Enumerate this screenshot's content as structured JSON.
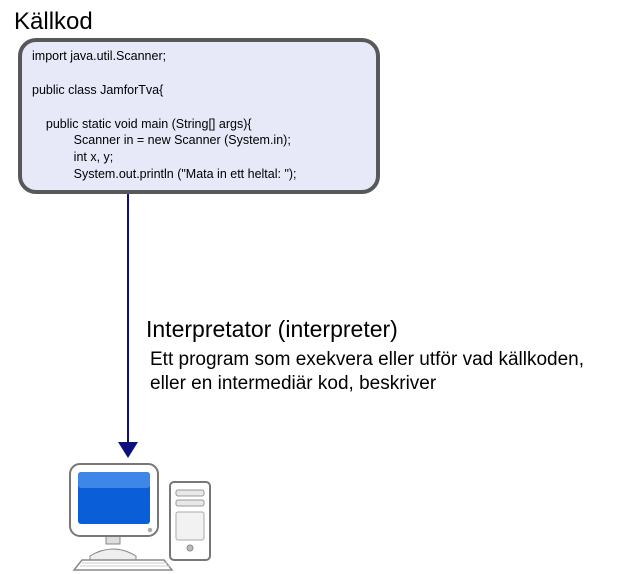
{
  "source": {
    "title": "Källkod",
    "code": "import java.util.Scanner;\n\npublic class JamforTva{\n\n    public static void main (String[] args){\n            Scanner in = new Scanner (System.in);\n            int x, y;\n            System.out.println (\"Mata in ett heltal: \");\n            ..."
  },
  "interpreter": {
    "title": "Interpretator (interpreter)",
    "description": "Ett program som exekvera eller utför vad källkoden, eller en intermediär kod,  beskriver"
  }
}
